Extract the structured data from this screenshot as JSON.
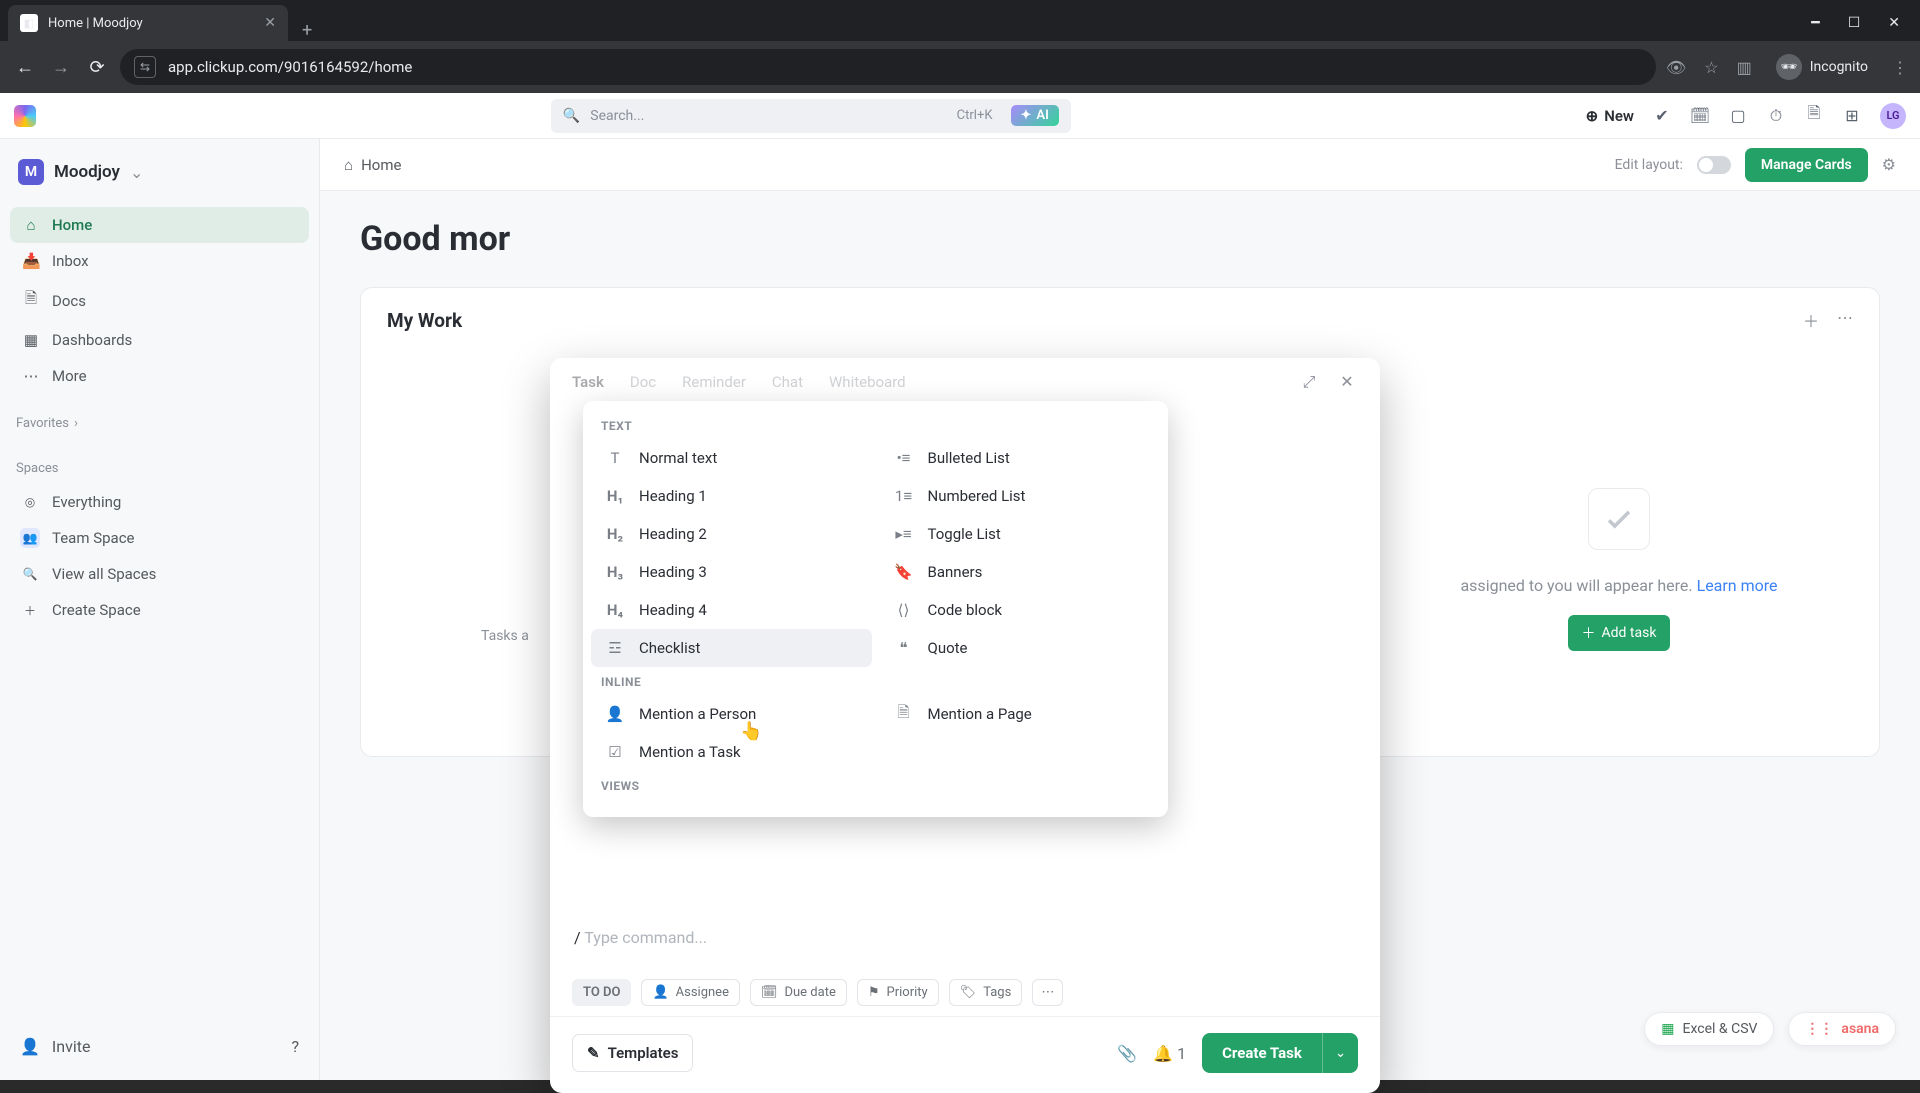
{
  "browser": {
    "tab_title": "Home | Moodjoy",
    "url": "app.clickup.com/9016164592/home",
    "incognito_label": "Incognito"
  },
  "header": {
    "search_placeholder": "Search...",
    "shortcut": "Ctrl+K",
    "ai_label": "AI",
    "new_label": "New",
    "avatar_initials": "LG"
  },
  "workspace": {
    "badge": "M",
    "name": "Moodjoy"
  },
  "sidebar": {
    "items": [
      {
        "label": "Home"
      },
      {
        "label": "Inbox"
      },
      {
        "label": "Docs"
      },
      {
        "label": "Dashboards"
      },
      {
        "label": "More"
      }
    ],
    "favorites_label": "Favorites",
    "spaces_label": "Spaces",
    "spaces": [
      {
        "label": "Everything"
      },
      {
        "label": "Team Space"
      },
      {
        "label": "View all Spaces"
      },
      {
        "label": "Create Space"
      }
    ],
    "invite_label": "Invite"
  },
  "main": {
    "breadcrumb": "Home",
    "edit_layout": "Edit layout:",
    "manage_cards": "Manage Cards",
    "greeting_truncated": "Good mor",
    "card_title": "My Work",
    "tasks_hint_truncated": "Tasks a",
    "empty_text": "assigned to you will appear here.",
    "learn_more": "Learn more",
    "add_task": "Add task"
  },
  "modal": {
    "tabs": [
      "Task",
      "Doc",
      "Reminder",
      "Chat",
      "Whiteboard"
    ],
    "cmd_prefix": "/",
    "cmd_placeholder": "Type command...",
    "status": "TO DO",
    "chips": [
      {
        "label": "Assignee"
      },
      {
        "label": "Due date"
      },
      {
        "label": "Priority"
      },
      {
        "label": "Tags"
      }
    ],
    "templates": "Templates",
    "notify_count": "1",
    "create": "Create Task"
  },
  "slash_menu": {
    "cat_text": "TEXT",
    "cat_inline": "INLINE",
    "cat_views": "VIEWS",
    "left": [
      {
        "label": "Normal text"
      },
      {
        "label": "Heading 1"
      },
      {
        "label": "Heading 2"
      },
      {
        "label": "Heading 3"
      },
      {
        "label": "Heading 4"
      },
      {
        "label": "Checklist"
      }
    ],
    "right": [
      {
        "label": "Bulleted List"
      },
      {
        "label": "Numbered List"
      },
      {
        "label": "Toggle List"
      },
      {
        "label": "Banners"
      },
      {
        "label": "Code block"
      },
      {
        "label": "Quote"
      }
    ],
    "inline_left": [
      {
        "label": "Mention a Person"
      },
      {
        "label": "Mention a Task"
      }
    ],
    "inline_right": [
      {
        "label": "Mention a Page"
      }
    ]
  },
  "float": {
    "excel": "Excel & CSV",
    "asana": "asana"
  }
}
